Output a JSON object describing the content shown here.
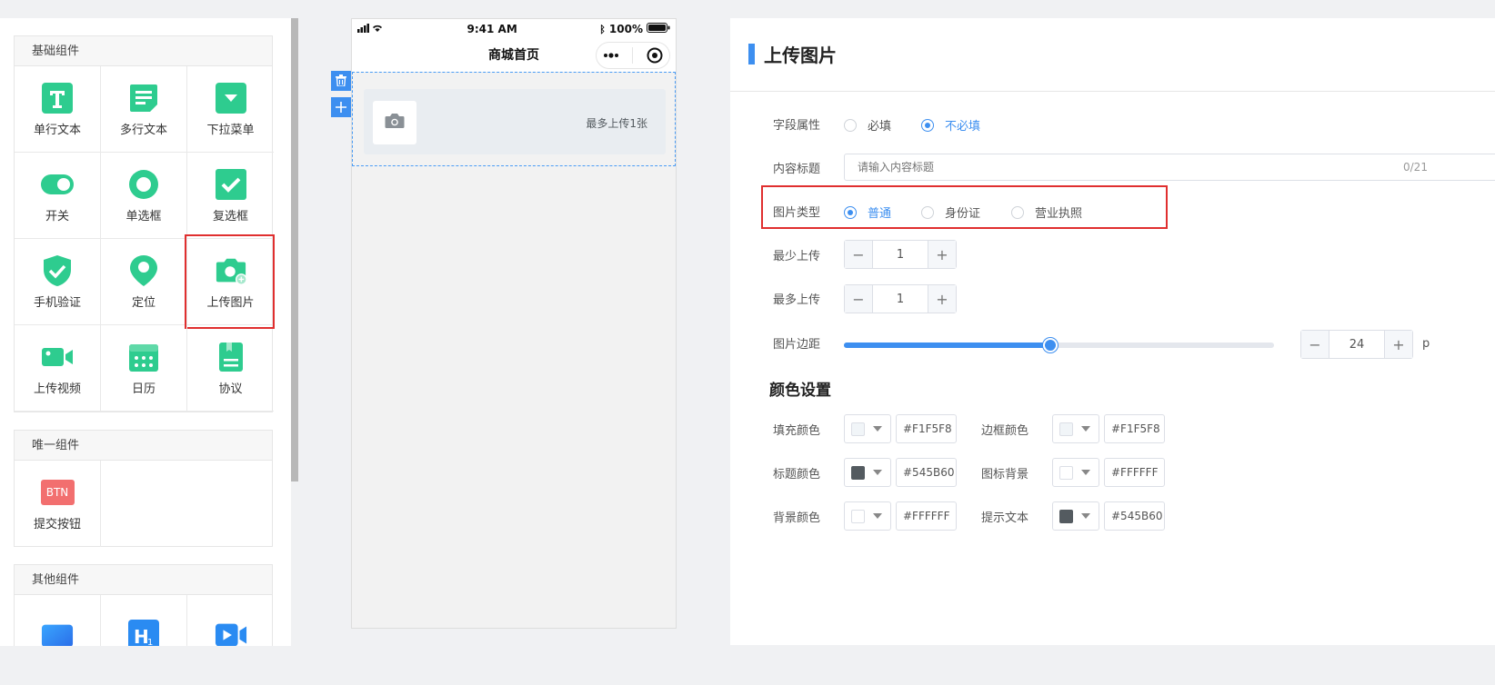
{
  "left_panel": {
    "basic": {
      "title": "基础组件",
      "items": [
        {
          "label": "单行文本",
          "icon": "text-t-icon"
        },
        {
          "label": "多行文本",
          "icon": "textarea-icon"
        },
        {
          "label": "下拉菜单",
          "icon": "dropdown-icon"
        },
        {
          "label": "开关",
          "icon": "toggle-icon"
        },
        {
          "label": "单选框",
          "icon": "radio-icon"
        },
        {
          "label": "复选框",
          "icon": "checkbox-icon"
        },
        {
          "label": "手机验证",
          "icon": "shield-check-icon"
        },
        {
          "label": "定位",
          "icon": "location-pin-icon"
        },
        {
          "label": "上传图片",
          "icon": "camera-plus-icon"
        },
        {
          "label": "上传视频",
          "icon": "video-camera-icon"
        },
        {
          "label": "日历",
          "icon": "calendar-icon"
        },
        {
          "label": "协议",
          "icon": "document-icon"
        }
      ]
    },
    "unique": {
      "title": "唯一组件",
      "items": [
        {
          "label": "提交按钮",
          "icon": "btn-badge-icon",
          "badge": "BTN"
        }
      ]
    },
    "other": {
      "title": "其他组件",
      "items": [
        {
          "label": "",
          "icon": "gradient-card-icon"
        },
        {
          "label": "",
          "icon": "heading-h1-icon"
        },
        {
          "label": "",
          "icon": "video-play-icon"
        }
      ]
    }
  },
  "phone": {
    "time": "9:41 AM",
    "battery": "100%",
    "nav_title": "商城首页",
    "upload_hint": "最多上传1张"
  },
  "right_panel": {
    "title": "上传图片",
    "field_attr": {
      "label": "字段属性",
      "options": [
        "必填",
        "不必填"
      ],
      "selected": 1
    },
    "content_title": {
      "label": "内容标题",
      "placeholder": "请输入内容标题",
      "count": "0/21"
    },
    "image_type": {
      "label": "图片类型",
      "options": [
        "普通",
        "身份证",
        "营业执照"
      ],
      "selected": 0
    },
    "min_upload": {
      "label": "最少上传",
      "value": "1"
    },
    "max_upload": {
      "label": "最多上传",
      "value": "1"
    },
    "margin": {
      "label": "图片边距",
      "value": "24",
      "unit": "p",
      "fraction": 0.48
    },
    "color_section": "颜色设置",
    "colors": [
      {
        "label": "填充颜色",
        "value": "#F1F5F8"
      },
      {
        "label": "边框颜色",
        "value": "#F1F5F8"
      },
      {
        "label": "标题颜色",
        "value": "#545B60"
      },
      {
        "label": "图标背景",
        "value": "#FFFFFF"
      },
      {
        "label": "背景颜色",
        "value": "#FFFFFF"
      },
      {
        "label": "提示文本",
        "value": "#545B60"
      }
    ]
  }
}
